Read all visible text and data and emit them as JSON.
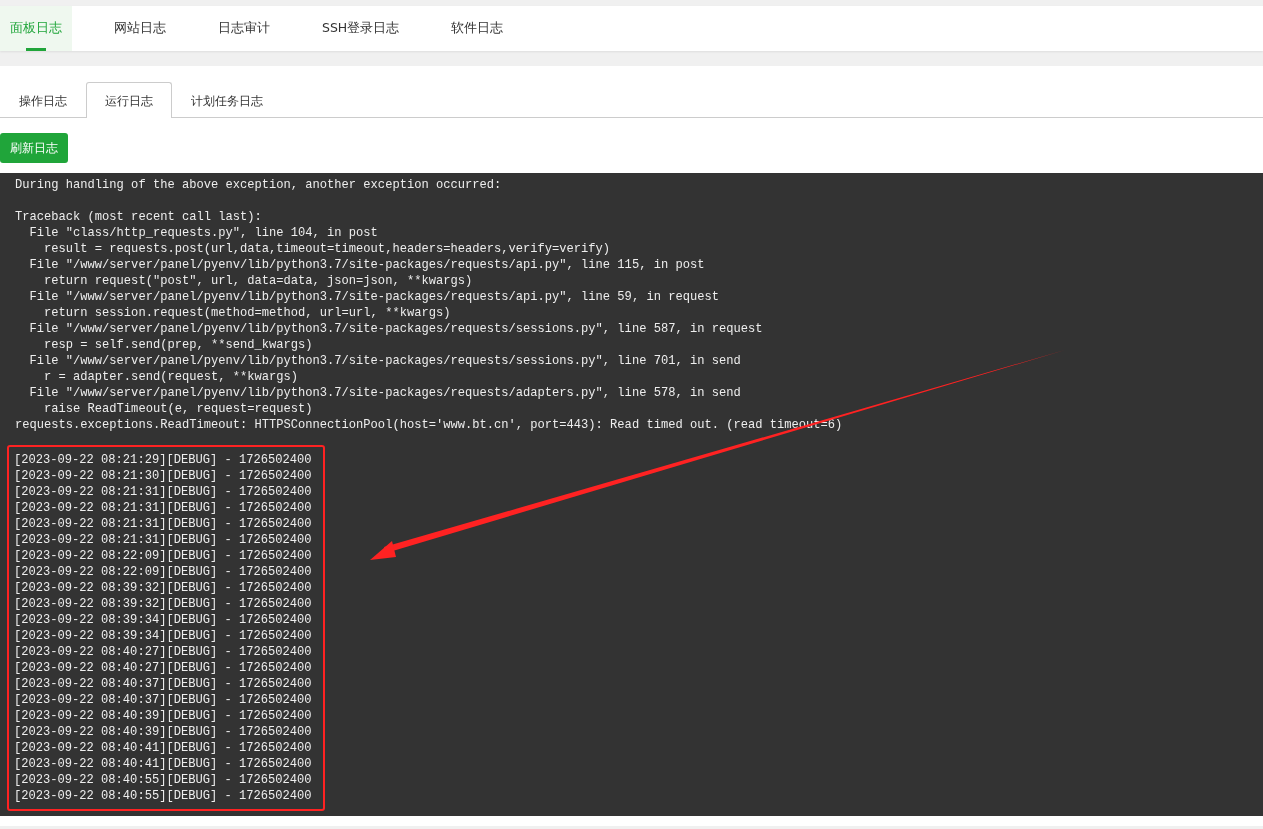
{
  "nav_tabs": [
    {
      "label": "面板日志",
      "selected": true
    },
    {
      "label": "网站日志",
      "selected": false
    },
    {
      "label": "日志审计",
      "selected": false
    },
    {
      "label": "SSH登录日志",
      "selected": false
    },
    {
      "label": "软件日志",
      "selected": false
    }
  ],
  "sub_tabs": [
    {
      "label": "操作日志",
      "selected": false
    },
    {
      "label": "运行日志",
      "selected": true
    },
    {
      "label": "计划任务日志",
      "selected": false
    }
  ],
  "refresh_button": "刷新日志",
  "log": {
    "blocks": [
      [
        "During handling of the above exception, another exception occurred:"
      ],
      [
        "Traceback (most recent call last):",
        "  File \"class/http_requests.py\", line 104, in post",
        "    result = requests.post(url,data,timeout=timeout,headers=headers,verify=verify)",
        "  File \"/www/server/panel/pyenv/lib/python3.7/site-packages/requests/api.py\", line 115, in post",
        "    return request(\"post\", url, data=data, json=json, **kwargs)",
        "  File \"/www/server/panel/pyenv/lib/python3.7/site-packages/requests/api.py\", line 59, in request",
        "    return session.request(method=method, url=url, **kwargs)",
        "  File \"/www/server/panel/pyenv/lib/python3.7/site-packages/requests/sessions.py\", line 587, in request",
        "    resp = self.send(prep, **send_kwargs)",
        "  File \"/www/server/panel/pyenv/lib/python3.7/site-packages/requests/sessions.py\", line 701, in send",
        "    r = adapter.send(request, **kwargs)",
        "  File \"/www/server/panel/pyenv/lib/python3.7/site-packages/requests/adapters.py\", line 578, in send",
        "    raise ReadTimeout(e, request=request)",
        "requests.exceptions.ReadTimeout: HTTPSConnectionPool(host='www.bt.cn', port=443): Read timed out. (read timeout=6)"
      ]
    ],
    "highlighted_lines": [
      "[2023-09-22 08:21:29][DEBUG] - 1726502400",
      "[2023-09-22 08:21:30][DEBUG] - 1726502400",
      "[2023-09-22 08:21:31][DEBUG] - 1726502400",
      "[2023-09-22 08:21:31][DEBUG] - 1726502400",
      "[2023-09-22 08:21:31][DEBUG] - 1726502400",
      "[2023-09-22 08:21:31][DEBUG] - 1726502400",
      "[2023-09-22 08:22:09][DEBUG] - 1726502400",
      "[2023-09-22 08:22:09][DEBUG] - 1726502400",
      "[2023-09-22 08:39:32][DEBUG] - 1726502400",
      "[2023-09-22 08:39:32][DEBUG] - 1726502400",
      "[2023-09-22 08:39:34][DEBUG] - 1726502400",
      "[2023-09-22 08:39:34][DEBUG] - 1726502400",
      "[2023-09-22 08:40:27][DEBUG] - 1726502400",
      "[2023-09-22 08:40:27][DEBUG] - 1726502400",
      "[2023-09-22 08:40:37][DEBUG] - 1726502400",
      "[2023-09-22 08:40:37][DEBUG] - 1726502400",
      "[2023-09-22 08:40:39][DEBUG] - 1726502400",
      "[2023-09-22 08:40:39][DEBUG] - 1726502400",
      "[2023-09-22 08:40:41][DEBUG] - 1726502400",
      "[2023-09-22 08:40:41][DEBUG] - 1726502400",
      "[2023-09-22 08:40:55][DEBUG] - 1726502400",
      "[2023-09-22 08:40:55][DEBUG] - 1726502400"
    ]
  }
}
